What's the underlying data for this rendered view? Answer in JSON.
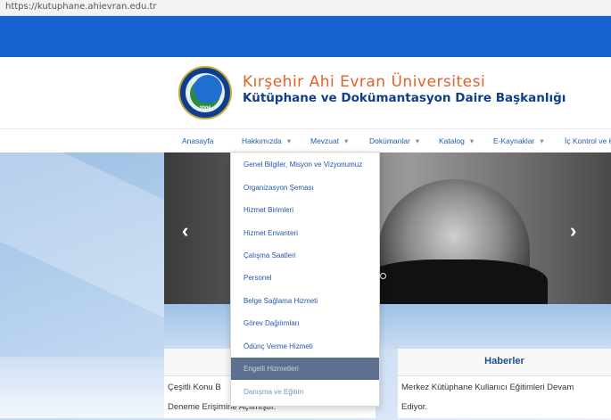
{
  "browser": {
    "url": "https://kutuphane.ahievran.edu.tr"
  },
  "header": {
    "university": "Kırşehir Ahi Evran Üniversitesi",
    "department": "Kütüphane ve Dokümantasyon Daire Başkanlığı",
    "logo_year": "2006"
  },
  "nav": {
    "items": [
      {
        "label": "Anasayfa",
        "dropdown": false
      },
      {
        "label": "Hakkımızda",
        "dropdown": true
      },
      {
        "label": "Mevzuat",
        "dropdown": true
      },
      {
        "label": "Dokümanlar",
        "dropdown": true
      },
      {
        "label": "Katalog",
        "dropdown": true
      },
      {
        "label": "E-Kaynaklar",
        "dropdown": true
      },
      {
        "label": "İç Kontrol ve K",
        "dropdown": false
      }
    ],
    "caret": "▾"
  },
  "dropdown": {
    "items": [
      "Genel Bilgiler, Misyon ve Vizyonumuz",
      "Organizasyon Şeması",
      "Hizmet Birimleri",
      "Hizmet Envanteri",
      "Çalışma Saatleri",
      "Personel",
      "Belge Sağlama Hizmeti",
      "Görev Dağılımları",
      "Ödünç Verme Hizmeti",
      "Engelli Hizmetleri",
      "Danışma ve Eğitim"
    ],
    "highlighted_index": 9
  },
  "slider": {
    "prev_icon": "‹",
    "next_icon": "›"
  },
  "cards": {
    "left": {
      "line1": "Çeşitli Konu B",
      "line2": "Deneme Erişim",
      "line2_tail": "ine Açılmıştır."
    },
    "right": {
      "title": "Haberler",
      "line1": "Merkez Kütüphane Kullanıcı Eğitimleri Devam",
      "line2": "Ediyor."
    }
  },
  "colors": {
    "brand_blue": "#1663d0",
    "title_orange": "#e0622a",
    "title_navy": "#0e3f8c",
    "nav_link": "#1f5fa8",
    "dropdown_active": "#5b6f8f"
  }
}
